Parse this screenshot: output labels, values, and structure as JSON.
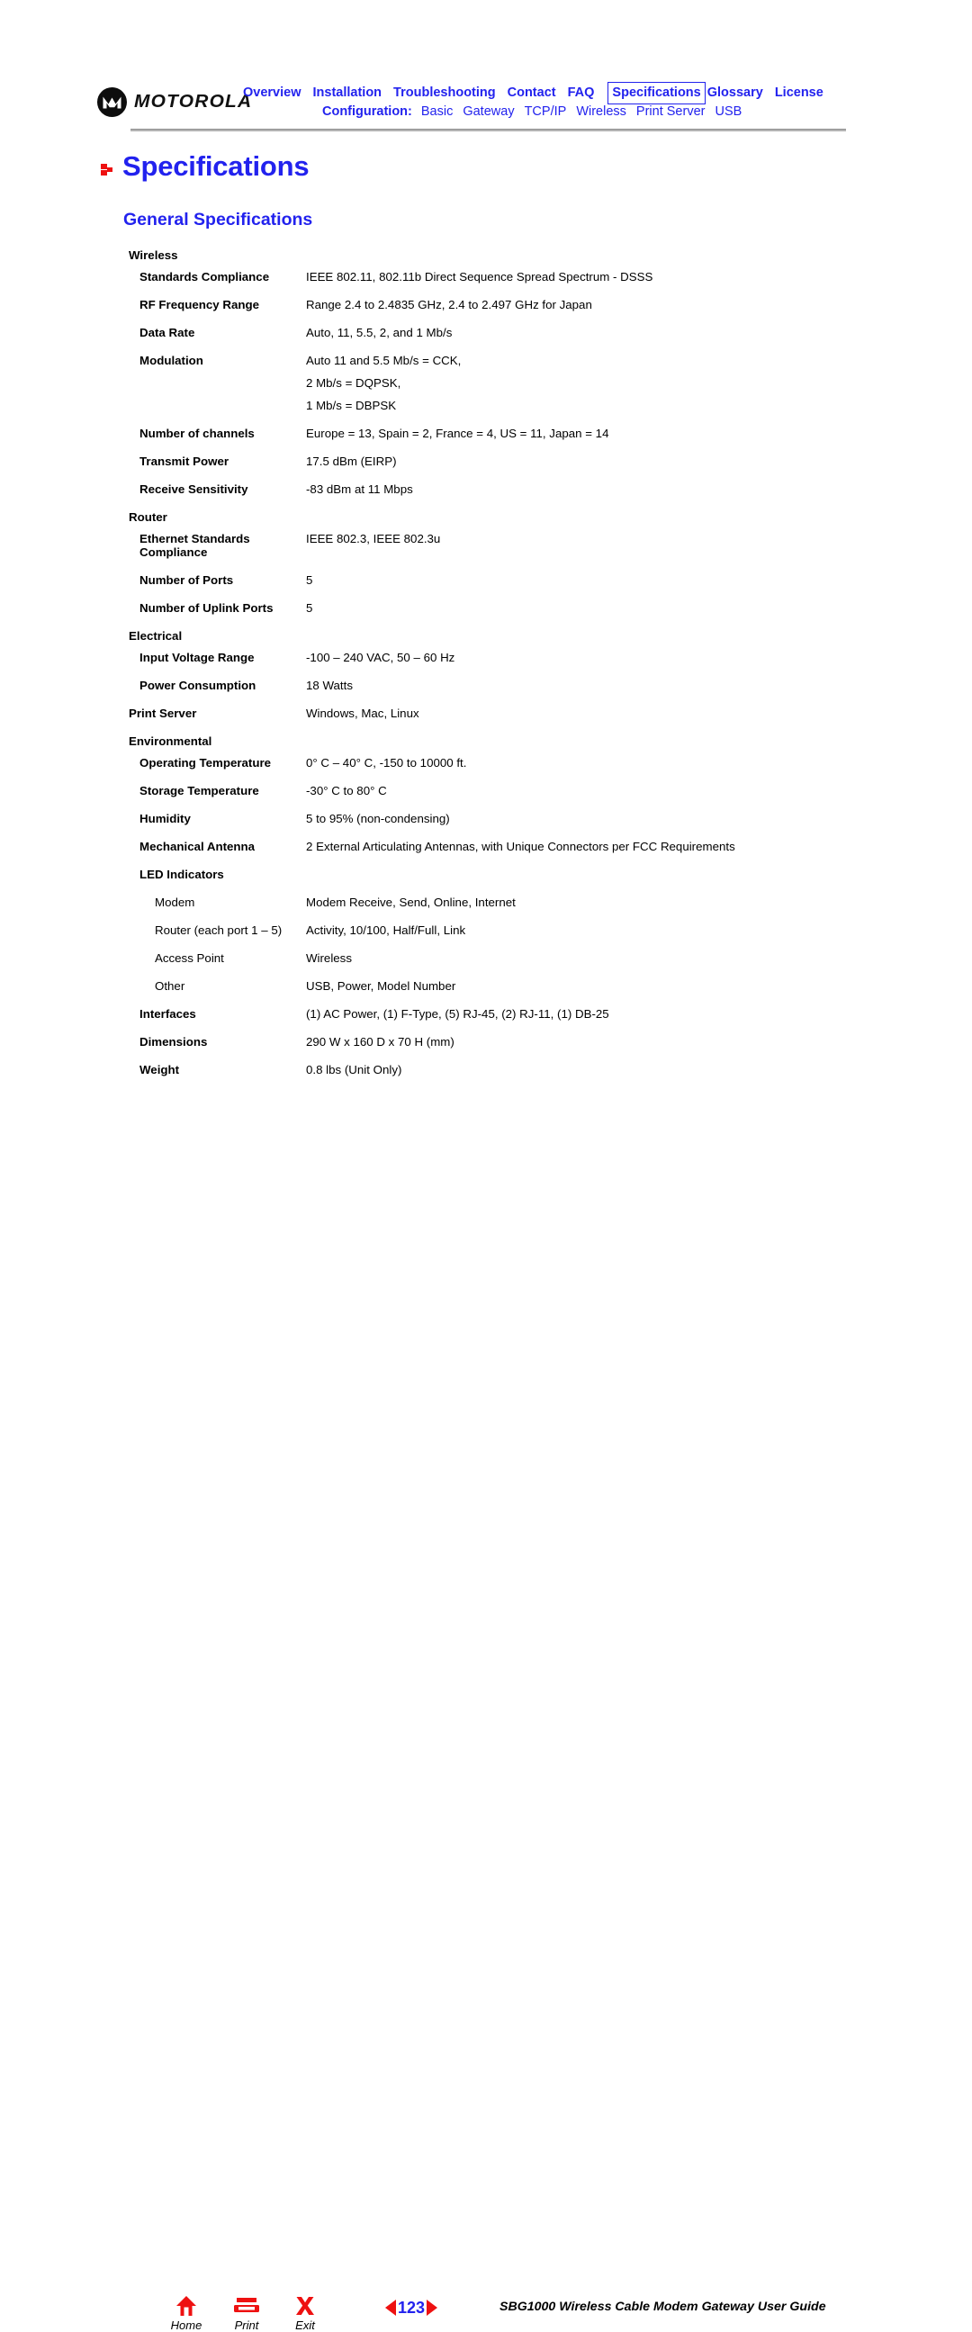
{
  "header": {
    "logo": {
      "wordmark": "MOTOROLA",
      "mark_icon": "motorola-m-logo"
    },
    "nav_primary": [
      {
        "label": "Overview",
        "boxed": false
      },
      {
        "label": "Installation",
        "boxed": false
      },
      {
        "label": "Troubleshooting",
        "boxed": false
      },
      {
        "label": "Contact",
        "boxed": false
      },
      {
        "label": "FAQ",
        "boxed": false
      },
      {
        "label": "Specifications",
        "boxed": true
      },
      {
        "label": "Glossary",
        "boxed": false
      },
      {
        "label": "License",
        "boxed": false
      }
    ],
    "nav_secondary_label": "Configuration:",
    "nav_secondary": [
      {
        "label": "Basic"
      },
      {
        "label": "Gateway"
      },
      {
        "label": "TCP/IP"
      },
      {
        "label": "Wireless"
      },
      {
        "label": "Print Server"
      },
      {
        "label": "USB"
      }
    ]
  },
  "page_title": "Specifications",
  "section_title": "General Specifications",
  "spec_rows": [
    {
      "type": "section",
      "label": "Wireless",
      "values": []
    },
    {
      "type": "item",
      "label": "Standards Compliance",
      "values": [
        "IEEE 802.11, 802.11b Direct Sequence Spread Spectrum - DSSS"
      ]
    },
    {
      "type": "item",
      "label": "RF Frequency Range",
      "values": [
        "Range 2.4 to 2.4835 GHz, 2.4 to 2.497 GHz for Japan"
      ]
    },
    {
      "type": "item",
      "label": "Data Rate",
      "values": [
        "Auto, 11, 5.5, 2, and 1 Mb/s"
      ]
    },
    {
      "type": "item",
      "label": "Modulation",
      "values": [
        "Auto 11 and 5.5 Mb/s = CCK,",
        "2 Mb/s = DQPSK,",
        "1 Mb/s = DBPSK"
      ]
    },
    {
      "type": "item",
      "label": "Number of channels",
      "values": [
        "Europe = 13, Spain = 2, France = 4, US = 11, Japan = 14"
      ]
    },
    {
      "type": "item",
      "label": "Transmit Power",
      "values": [
        "17.5 dBm (EIRP)"
      ]
    },
    {
      "type": "item",
      "label": "Receive Sensitivity",
      "values": [
        "-83 dBm at 11 Mbps"
      ]
    },
    {
      "type": "section",
      "label": "Router",
      "values": []
    },
    {
      "type": "item",
      "label": "Ethernet Standards\nCompliance",
      "values": [
        "IEEE 802.3, IEEE 802.3u"
      ]
    },
    {
      "type": "item",
      "label": "Number of Ports",
      "values": [
        "5"
      ]
    },
    {
      "type": "item",
      "label": "Number of Uplink Ports",
      "values": [
        "5"
      ]
    },
    {
      "type": "section",
      "label": "Electrical",
      "values": []
    },
    {
      "type": "item",
      "label": "Input Voltage Range",
      "values": [
        "-100 – 240 VAC, 50 – 60 Hz"
      ]
    },
    {
      "type": "item",
      "label": "Power Consumption",
      "values": [
        "18 Watts"
      ]
    },
    {
      "type": "section",
      "label": "Print Server",
      "values": [
        "Windows, Mac, Linux"
      ]
    },
    {
      "type": "section",
      "label": "Environmental",
      "values": []
    },
    {
      "type": "item",
      "label": "Operating Temperature",
      "values": [
        "0° C – 40° C, -150 to 10000 ft."
      ]
    },
    {
      "type": "item",
      "label": "Storage Temperature",
      "values": [
        "-30° C to 80° C"
      ]
    },
    {
      "type": "item",
      "label": "Humidity",
      "values": [
        "5 to 95% (non-condensing)"
      ]
    },
    {
      "type": "item",
      "label": "Mechanical Antenna",
      "values": [
        "2 External Articulating Antennas, with Unique Connectors per FCC Requirements"
      ]
    },
    {
      "type": "item",
      "label": "LED Indicators",
      "values": []
    },
    {
      "type": "sub",
      "label": "Modem",
      "values": [
        "Modem Receive, Send, Online, Internet"
      ]
    },
    {
      "type": "sub",
      "label": "Router (each port 1 – 5)",
      "values": [
        "Activity, 10/100, Half/Full, Link"
      ]
    },
    {
      "type": "sub",
      "label": "Access Point",
      "values": [
        "Wireless"
      ]
    },
    {
      "type": "sub",
      "label": "Other",
      "values": [
        "USB, Power, Model Number"
      ]
    },
    {
      "type": "item",
      "label": "Interfaces",
      "values": [
        "(1) AC Power, (1) F-Type, (5) RJ-45, (2) RJ-11, (1) DB-25"
      ]
    },
    {
      "type": "item",
      "label": "Dimensions",
      "values": [
        "290 W x 160 D x 70 H (mm)"
      ]
    },
    {
      "type": "item",
      "label": "Weight",
      "values": [
        "0.8 lbs (Unit Only)"
      ]
    }
  ],
  "footer": {
    "buttons": [
      {
        "label": "Home",
        "icon": "home-icon"
      },
      {
        "label": "Print",
        "icon": "printer-icon"
      },
      {
        "label": "Exit",
        "icon": "exit-x-icon"
      }
    ],
    "pager": {
      "prev_icon": "triangle-left-icon",
      "number": "123",
      "next_icon": "triangle-right-icon"
    },
    "doc_title": "SBG1000 Wireless Cable Modem Gateway User Guide"
  },
  "colors": {
    "link_blue": "#2222ee",
    "accent_red": "#ee1111",
    "rule_gray": "#b4b4b4",
    "text_black": "#000000"
  }
}
